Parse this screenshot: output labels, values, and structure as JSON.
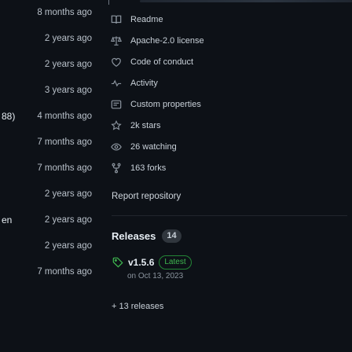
{
  "file_list": {
    "rows": [
      {
        "fragment": "",
        "timestamp": "8 months ago"
      },
      {
        "fragment": "",
        "timestamp": "2 years ago"
      },
      {
        "fragment": "",
        "timestamp": "2 years ago"
      },
      {
        "fragment": "",
        "timestamp": "3 years ago"
      },
      {
        "fragment": "88)",
        "timestamp": "4 months ago"
      },
      {
        "fragment": "",
        "timestamp": "7 months ago"
      },
      {
        "fragment": "",
        "timestamp": "7 months ago"
      },
      {
        "fragment": "",
        "timestamp": "2 years ago"
      },
      {
        "fragment": "en",
        "timestamp": "2 years ago"
      },
      {
        "fragment": "",
        "timestamp": "2 years ago"
      },
      {
        "fragment": "",
        "timestamp": "7 months ago"
      }
    ]
  },
  "about": {
    "items": [
      {
        "icon": "book-icon",
        "label": "Readme"
      },
      {
        "icon": "law-icon",
        "label": "Apache-2.0 license"
      },
      {
        "icon": "code-of-conduct-icon",
        "label": "Code of conduct"
      },
      {
        "icon": "pulse-icon",
        "label": "Activity"
      },
      {
        "icon": "custom-properties-icon",
        "label": "Custom properties"
      },
      {
        "icon": "star-icon",
        "label": "2k stars"
      },
      {
        "icon": "eye-icon",
        "label": "26 watching"
      },
      {
        "icon": "fork-icon",
        "label": "163 forks"
      }
    ],
    "report_link": "Report repository"
  },
  "releases": {
    "heading": "Releases",
    "count": "14",
    "latest": {
      "version": "v1.5.6",
      "badge": "Latest",
      "date": "on Oct 13, 2023"
    },
    "more_link": "+ 13 releases"
  },
  "colors": {
    "background": "#0d1117",
    "text": "#e6edf3",
    "muted": "#8b949e",
    "accent_green": "#3fb950"
  }
}
